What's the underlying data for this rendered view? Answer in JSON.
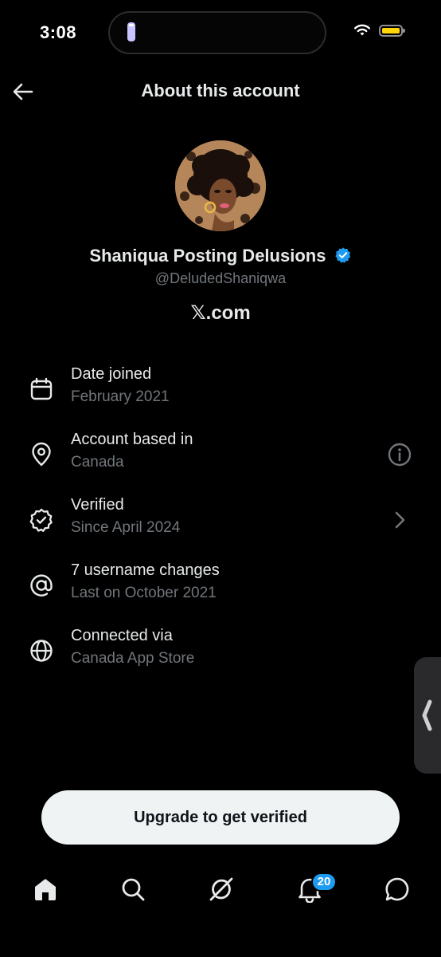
{
  "status_bar": {
    "time": "3:08"
  },
  "header": {
    "title": "About this account"
  },
  "profile": {
    "name": "Shaniqua Posting Delusions",
    "handle": "@DeludedShaniqwa",
    "platform": "𝕏.com",
    "verified": true
  },
  "info": {
    "date_joined": {
      "title": "Date joined",
      "value": "February 2021",
      "icon": "calendar-icon"
    },
    "based_in": {
      "title": "Account based in",
      "value": "Canada",
      "icon": "location-pin-icon",
      "action_icon": "info-icon"
    },
    "verified": {
      "title": "Verified",
      "value": "Since April 2024",
      "icon": "verified-badge-icon",
      "action_icon": "chevron-right-icon"
    },
    "username_changes": {
      "title": "7 username changes",
      "value": "Last on October 2021",
      "icon": "at-sign-icon"
    },
    "connected_via": {
      "title": "Connected via",
      "value": "Canada App Store",
      "icon": "globe-icon"
    }
  },
  "upgrade_button": {
    "label": "Upgrade to get verified"
  },
  "bottom_nav": {
    "items": [
      "home-icon",
      "search-icon",
      "grok-icon",
      "notifications-icon",
      "messages-icon"
    ],
    "notifications_count": "20"
  },
  "colors": {
    "background": "#000000",
    "text_primary": "#e7e9ea",
    "text_secondary": "#71767b",
    "accent_blue": "#1d9bf0",
    "button_bg": "#eff3f4"
  }
}
